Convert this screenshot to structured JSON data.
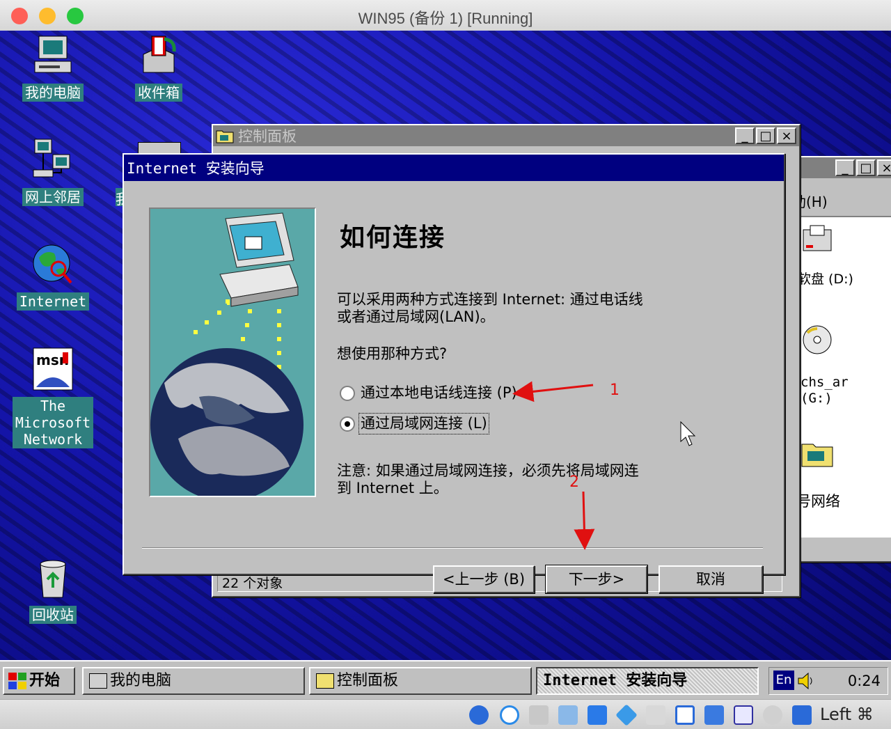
{
  "window": {
    "title": "WIN95 (备份 1) [Running]",
    "traffic_colors": [
      "#fe5f57",
      "#febc2e",
      "#28c840"
    ]
  },
  "desktop": {
    "icons": [
      {
        "label": "我的电脑",
        "icon": "computer-icon"
      },
      {
        "label": "收件箱",
        "icon": "inbox-icon"
      },
      {
        "label": "网上邻居",
        "icon": "network-icon"
      },
      {
        "label": "Internet",
        "icon": "internet-globe-icon"
      },
      {
        "label": "The\nMicrosoft\nNetwork",
        "icon": "msn-icon"
      },
      {
        "label": "回收站",
        "icon": "recycle-bin-icon"
      }
    ],
    "partial_label": "我"
  },
  "control_panel": {
    "title": "控制面板",
    "status": "22 个对象"
  },
  "back_window": {
    "menu": "助(H)",
    "items": [
      "软盘 (D:)",
      "chs_ar\n(G:)",
      "号网络"
    ]
  },
  "wizard": {
    "title": "Internet 安装向导",
    "heading": "如何连接",
    "desc": "可以采用两种方式连接到 Internet: 通过电话线\n或者通过局域网(LAN)。",
    "question": "想使用那种方式?",
    "option_phone": "通过本地电话线连接 (P)",
    "option_lan": "通过局域网连接 (L)",
    "selected": "lan",
    "note": "注意: 如果通过局域网连接，必须先将局域网连\n到 Internet 上。",
    "back_button": "<上一步 (B)",
    "next_button": "下一步>",
    "cancel_button": "取消"
  },
  "annotations": [
    {
      "text": "1",
      "color": "#e01010"
    },
    {
      "text": "2",
      "color": "#e01010"
    }
  ],
  "taskbar": {
    "start": "开始",
    "items": [
      "我的电脑",
      "控制面板",
      "Internet 安装向导"
    ],
    "ime": "En",
    "clock": "0:24"
  },
  "vbox": {
    "host_key": "Left ⌘"
  }
}
